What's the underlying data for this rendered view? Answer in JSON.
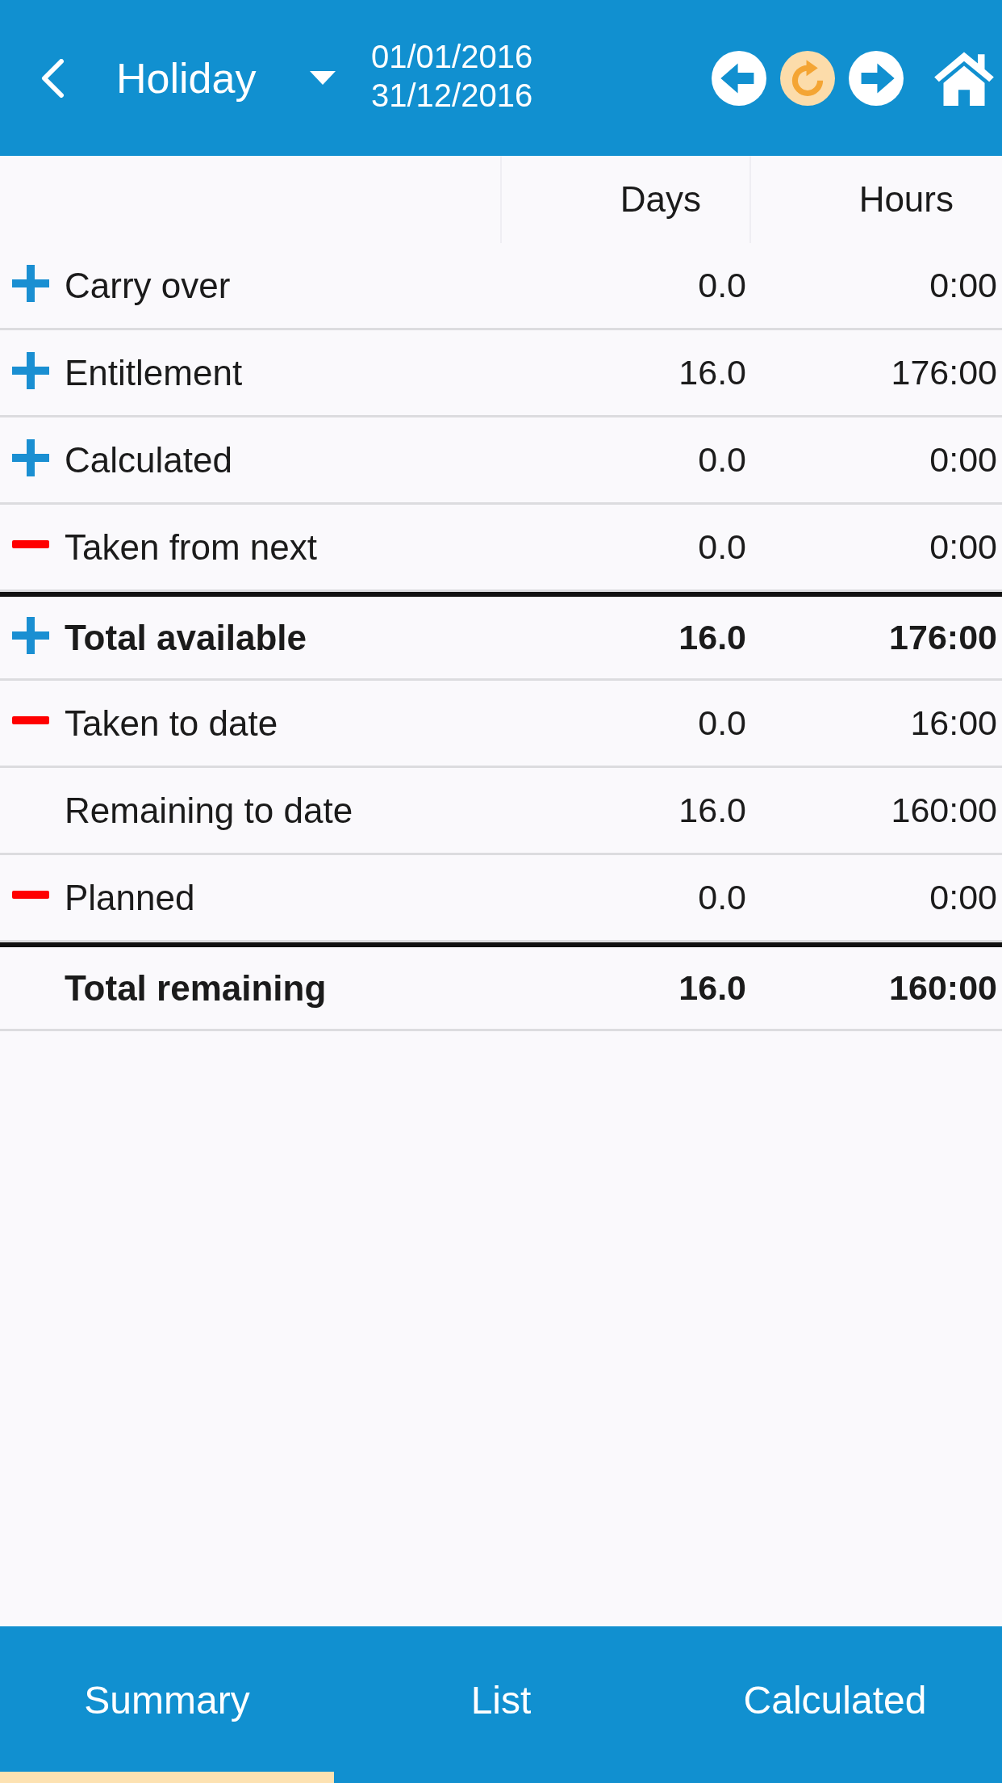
{
  "header": {
    "title": "Holiday",
    "date_from": "01/01/2016",
    "date_to": "31/12/2016"
  },
  "table": {
    "columns": [
      "Days",
      "Hours"
    ],
    "rows": [
      {
        "label": "Carry over",
        "kind": "plus",
        "total": false,
        "days": "0.0",
        "hours": "0:00"
      },
      {
        "label": "Entitlement",
        "kind": "plus",
        "total": false,
        "days": "16.0",
        "hours": "176:00"
      },
      {
        "label": "Calculated",
        "kind": "plus",
        "total": false,
        "days": "0.0",
        "hours": "0:00"
      },
      {
        "label": "Taken from next",
        "kind": "minus",
        "total": false,
        "days": "0.0",
        "hours": "0:00"
      },
      {
        "label": "Total available",
        "kind": "plus",
        "total": true,
        "days": "16.0",
        "hours": "176:00"
      },
      {
        "label": "Taken to date",
        "kind": "minus",
        "total": false,
        "days": "0.0",
        "hours": "16:00"
      },
      {
        "label": "Remaining to date",
        "kind": "plain",
        "total": false,
        "days": "16.0",
        "hours": "160:00"
      },
      {
        "label": "Planned",
        "kind": "minus",
        "total": false,
        "days": "0.0",
        "hours": "0:00"
      },
      {
        "label": "Total remaining",
        "kind": "plain",
        "total": true,
        "days": "16.0",
        "hours": "160:00"
      }
    ]
  },
  "tabs": [
    {
      "label": "Summary",
      "selected": true
    },
    {
      "label": "List",
      "selected": false
    },
    {
      "label": "Calculated",
      "selected": false
    }
  ]
}
